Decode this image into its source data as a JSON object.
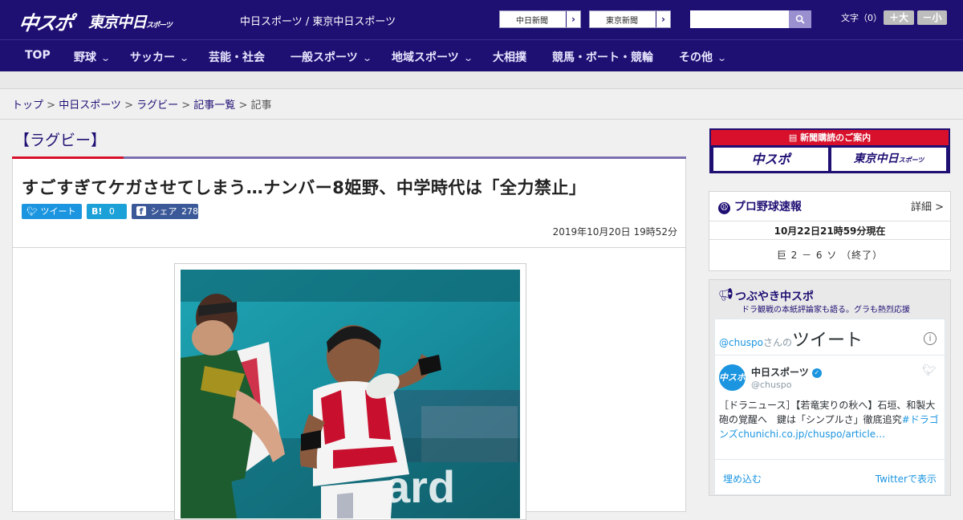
{
  "header": {
    "logo_main": "中スポ",
    "logo_tokyo": "東京中日",
    "logo_tokyo_small": "スポーツ",
    "site_links": "中日スポーツ / 東京中日スポーツ",
    "paper_links": [
      "中日新聞",
      "東京新聞"
    ],
    "search": {
      "placeholder": "",
      "button_icon": "search-icon"
    },
    "font_size_label": "文字（0）",
    "size_plus": "＋大",
    "size_minus": "－小"
  },
  "nav": {
    "items": [
      {
        "label": "TOP"
      },
      {
        "label": "野球"
      },
      {
        "label": "サッカー"
      },
      {
        "label": "芸能・社会"
      },
      {
        "label": "一般スポーツ"
      },
      {
        "label": "地域スポーツ"
      },
      {
        "label": "大相撲"
      },
      {
        "label": "競馬・ボート・競輪"
      },
      {
        "label": "その他"
      }
    ],
    "chevron": "⌄"
  },
  "breadcrumb": [
    "トップ",
    "中日スポーツ",
    "ラグビー",
    "記事一覧",
    "記事"
  ],
  "breadcrumb_sep": " > ",
  "article": {
    "category": "【ラグビー】",
    "headline": "すごすぎてケガさせてしまう…ナンバー8姫野、中学時代は「全力禁止」",
    "share": {
      "tweet": "ツイート",
      "hatena_icon": "B!",
      "hatena_count": "0",
      "facebook_icon": "f",
      "facebook_label": "シェア",
      "facebook_count": "278"
    },
    "date": "2019年10月20日 19時52分"
  },
  "sidebar": {
    "ad": {
      "title": "新聞購読のご案内",
      "brand_1": "中スポ",
      "brand_2": "東京中日",
      "brand_2_small": "スポーツ"
    },
    "baseball": {
      "title": "プロ野球速報",
      "detail": "詳細 >",
      "time": "10月22日21時59分現在",
      "score": "巨 2 － 6 ソ （終了）"
    },
    "tweets": {
      "title": "つぶやき中スポ",
      "subtitle": "ドラ観戦の本紙評論家も語る。グラも熱烈応援",
      "widget_handle_prefix": "@chuspo",
      "widget_handle_suffix": "さんの",
      "widget_heading": "ツイート",
      "info": "i",
      "account_name": "中日スポーツ",
      "account_handle": "@chuspo",
      "avatar_text": "中スポ",
      "tweet_text": "［ドラニュース］【若竜実りの秋へ】石垣、和製大砲の覚醒へ　鍵は「シンプルさ」徹底追究",
      "tweet_tag": "#ドラゴンズ",
      "tweet_link": "chunichi.co.jp/chuspo/article…",
      "embed": "埋め込む",
      "view_on": "Twitterで表示"
    }
  },
  "colors": {
    "brand": "#1e0f73",
    "accent_red": "#d8102b",
    "twitter": "#1b95e0",
    "facebook": "#3b5998",
    "hatena": "#00a4de"
  }
}
